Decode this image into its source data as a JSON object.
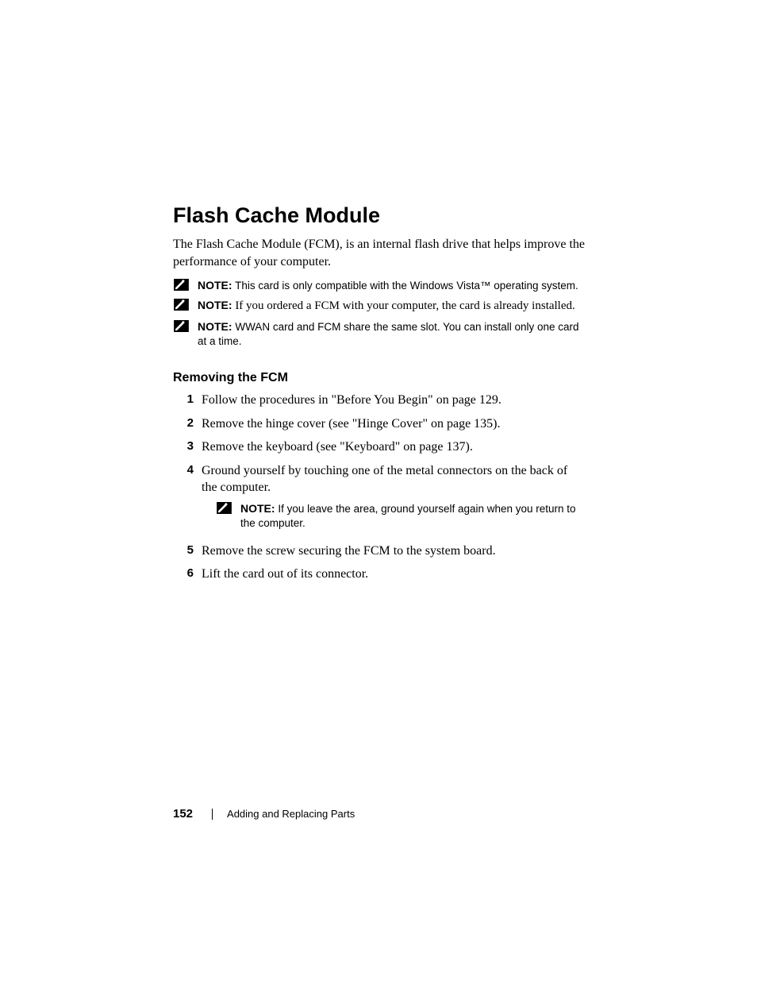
{
  "heading": "Flash Cache Module",
  "intro": "The Flash Cache Module (FCM), is an internal flash drive that helps improve the performance of your computer.",
  "notes": [
    {
      "label": "NOTE:",
      "text": "This card is only compatible with the Windows Vista™ operating system.",
      "style": "sans"
    },
    {
      "label": "NOTE:",
      "text": "If you ordered a FCM with your computer, the card is already installed.",
      "style": "serif"
    },
    {
      "label": "NOTE:",
      "text": "WWAN card and FCM share the same slot. You can install only one card at a time.",
      "style": "sans"
    }
  ],
  "subheading": "Removing the FCM",
  "steps": [
    {
      "num": "1",
      "text": "Follow the procedures in \"Before You Begin\" on page 129."
    },
    {
      "num": "2",
      "text": "Remove the hinge cover (see \"Hinge Cover\" on page 135)."
    },
    {
      "num": "3",
      "text": "Remove the keyboard (see \"Keyboard\" on page 137)."
    },
    {
      "num": "4",
      "text": "Ground yourself by touching one of the metal connectors on the back of the computer.",
      "subnote": {
        "label": "NOTE:",
        "text": "If you leave the area, ground yourself again when you return to the computer."
      }
    },
    {
      "num": "5",
      "text": "Remove the screw securing the FCM to the system board."
    },
    {
      "num": "6",
      "text": "Lift the card out of its connector."
    }
  ],
  "footer": {
    "page": "152",
    "section": "Adding and Replacing Parts"
  }
}
